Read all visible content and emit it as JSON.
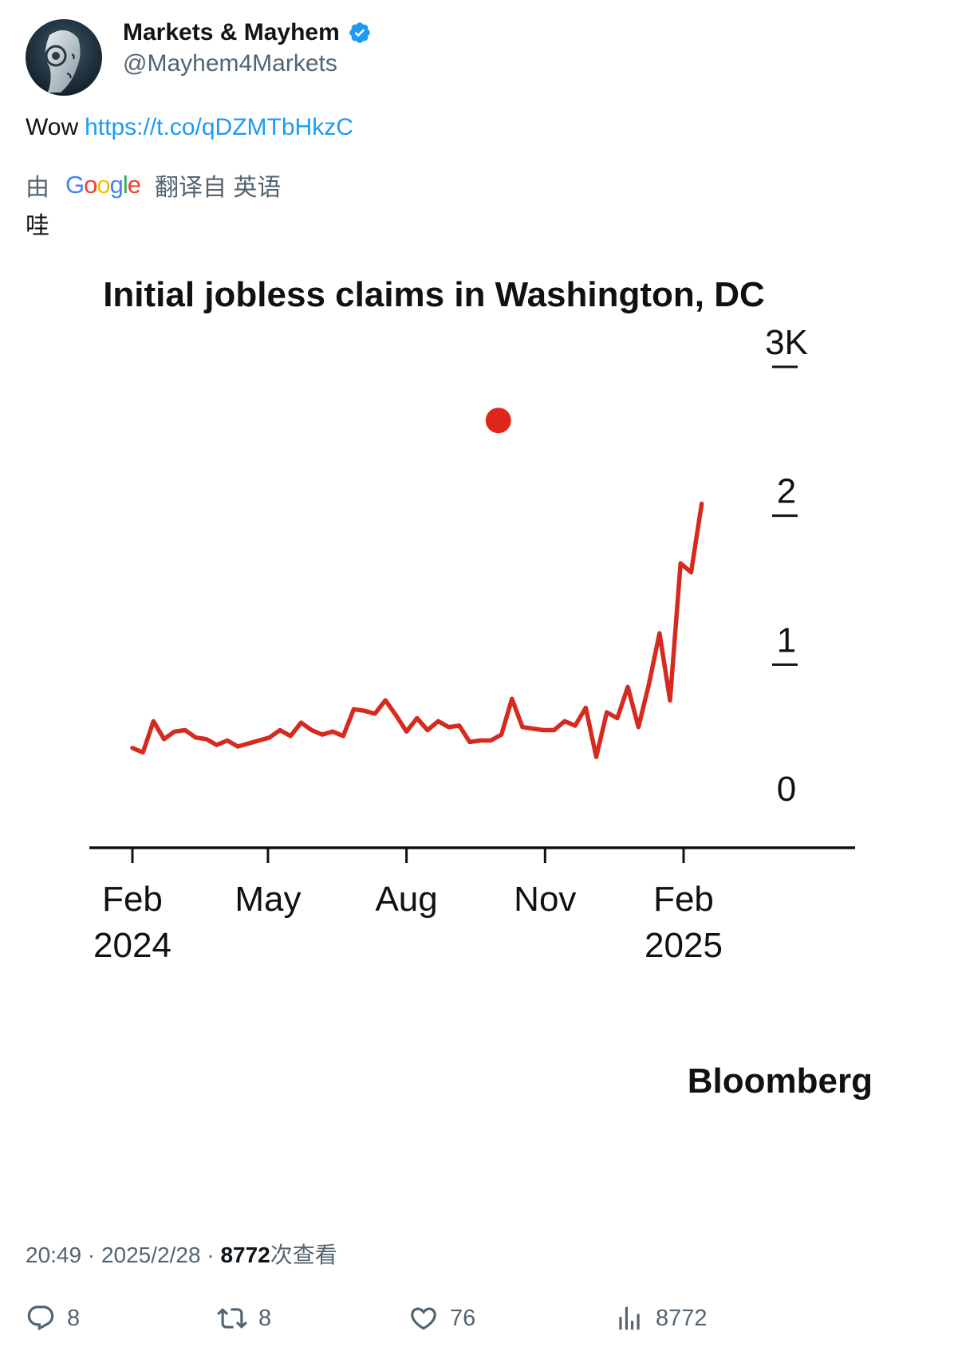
{
  "author": {
    "name": "Markets & Mayhem",
    "handle": "@Mayhem4Markets",
    "avatar_icon": "robot-face-avatar",
    "verified_color": "#1d9bf0"
  },
  "tweet": {
    "text": "Wow",
    "link": "https://t.co/qDZMTbHkzC"
  },
  "translation": {
    "prefix": "由",
    "provider_letters": [
      "G",
      "o",
      "o",
      "g",
      "l",
      "e"
    ],
    "suffix": "翻译自 英语",
    "text": "哇"
  },
  "chart_data": {
    "type": "line",
    "title": "Initial jobless claims in Washington, DC",
    "y_ticks": [
      "0",
      "1",
      "2",
      "3K"
    ],
    "ylim": [
      0,
      3000
    ],
    "x_ticks": [
      {
        "label": "Feb",
        "sub": "2024"
      },
      {
        "label": "May",
        "sub": ""
      },
      {
        "label": "Aug",
        "sub": ""
      },
      {
        "label": "Nov",
        "sub": ""
      },
      {
        "label": "Feb",
        "sub": "2025"
      }
    ],
    "x_tick_dates": [
      "2024-02-01",
      "2024-05-01",
      "2024-08-01",
      "2024-11-01",
      "2025-02-01"
    ],
    "series": [
      {
        "color": "#d62a20",
        "points": [
          [
            "2024-02-01",
            440
          ],
          [
            "2024-02-08",
            410
          ],
          [
            "2024-02-15",
            620
          ],
          [
            "2024-02-22",
            500
          ],
          [
            "2024-02-29",
            550
          ],
          [
            "2024-03-07",
            560
          ],
          [
            "2024-03-14",
            510
          ],
          [
            "2024-03-21",
            500
          ],
          [
            "2024-03-28",
            460
          ],
          [
            "2024-04-04",
            490
          ],
          [
            "2024-04-11",
            450
          ],
          [
            "2024-04-18",
            470
          ],
          [
            "2024-04-25",
            490
          ],
          [
            "2024-05-02",
            510
          ],
          [
            "2024-05-09",
            560
          ],
          [
            "2024-05-16",
            520
          ],
          [
            "2024-05-23",
            610
          ],
          [
            "2024-05-30",
            560
          ],
          [
            "2024-06-06",
            530
          ],
          [
            "2024-06-13",
            550
          ],
          [
            "2024-06-20",
            520
          ],
          [
            "2024-06-27",
            700
          ],
          [
            "2024-07-04",
            690
          ],
          [
            "2024-07-11",
            670
          ],
          [
            "2024-07-18",
            760
          ],
          [
            "2024-07-25",
            660
          ],
          [
            "2024-08-01",
            550
          ],
          [
            "2024-08-08",
            640
          ],
          [
            "2024-08-15",
            560
          ],
          [
            "2024-08-22",
            620
          ],
          [
            "2024-08-29",
            580
          ],
          [
            "2024-09-05",
            590
          ],
          [
            "2024-09-12",
            480
          ],
          [
            "2024-09-19",
            490
          ],
          [
            "2024-09-26",
            490
          ],
          [
            "2024-10-03",
            530
          ],
          [
            "2024-10-10",
            770
          ],
          [
            "2024-10-17",
            580
          ],
          [
            "2024-10-24",
            570
          ],
          [
            "2024-10-31",
            560
          ],
          [
            "2024-11-07",
            560
          ],
          [
            "2024-11-14",
            620
          ],
          [
            "2024-11-21",
            590
          ],
          [
            "2024-11-28",
            710
          ],
          [
            "2024-12-05",
            380
          ],
          [
            "2024-12-12",
            680
          ],
          [
            "2024-12-19",
            640
          ],
          [
            "2024-12-26",
            850
          ],
          [
            "2025-01-02",
            580
          ],
          [
            "2025-01-09",
            870
          ],
          [
            "2025-01-16",
            1210
          ],
          [
            "2025-01-23",
            760
          ],
          [
            "2025-01-30",
            1680
          ],
          [
            "2025-02-06",
            1620
          ],
          [
            "2025-02-13",
            2080
          ]
        ]
      }
    ],
    "highlight_point": {
      "date": "2024-10-01",
      "value": 2640,
      "color": "#e0261a"
    },
    "source": "Bloomberg"
  },
  "meta": {
    "time": "20:49",
    "separator": " · ",
    "date": "2025/2/28",
    "views": "8772",
    "views_suffix": "次查看"
  },
  "actions": {
    "replies": "8",
    "reposts": "8",
    "likes": "76",
    "views": "8772"
  }
}
